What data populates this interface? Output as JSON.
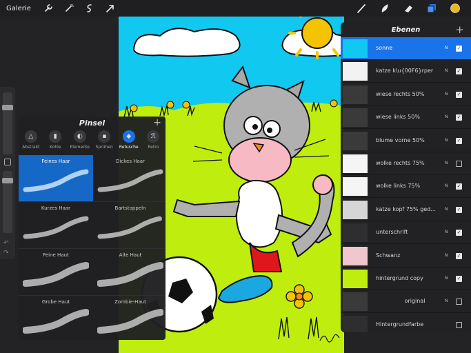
{
  "topbar": {
    "gallery_label": "Galerie",
    "left_tools": [
      "wrench-icon",
      "magic-wand-icon",
      "selection-icon",
      "transform-arrow-icon"
    ],
    "right_tools": [
      "brush-icon",
      "smudge-icon",
      "eraser-icon",
      "layers-icon"
    ],
    "active_color": "#e9b81e",
    "accent": "#1a73e8"
  },
  "brushes": {
    "title": "Pinsel",
    "categories": [
      {
        "label": "Abstrakt",
        "icon": "triangle-icon"
      },
      {
        "label": "Kohle",
        "icon": "charcoal-icon"
      },
      {
        "label": "Elemente",
        "icon": "elements-icon"
      },
      {
        "label": "Sprühen",
        "icon": "spray-icon"
      },
      {
        "label": "Retusche",
        "icon": "droplet-icon"
      },
      {
        "label": "Retro",
        "icon": "retro-icon"
      }
    ],
    "active_category": "Retusche",
    "items": [
      {
        "name": "Feines Haar",
        "selected": true
      },
      {
        "name": "Dickes Haar",
        "selected": false
      },
      {
        "name": "Kurzes Haar",
        "selected": false
      },
      {
        "name": "Bartstoppeln",
        "selected": false
      },
      {
        "name": "Feine Haut",
        "selected": false
      },
      {
        "name": "Alte Haut",
        "selected": false
      },
      {
        "name": "Grobe Haut",
        "selected": false
      },
      {
        "name": "Zombie-Haut",
        "selected": false
      }
    ]
  },
  "layers": {
    "title": "Ebenen",
    "items": [
      {
        "name": "sonne",
        "mode": "N",
        "visible": true,
        "selected": true
      },
      {
        "name": "katze k\\u{00F6}rper",
        "mode": "N",
        "visible": true,
        "selected": false
      },
      {
        "name": "wiese rechts 50%",
        "mode": "N",
        "visible": true,
        "selected": false
      },
      {
        "name": "wiese links 50%",
        "mode": "N",
        "visible": true,
        "selected": false
      },
      {
        "name": "blume vorne 50%",
        "mode": "N",
        "visible": true,
        "selected": false
      },
      {
        "name": "wolke rechts 75%",
        "mode": "N",
        "visible": false,
        "selected": false
      },
      {
        "name": "wolke links 75%",
        "mode": "N",
        "visible": true,
        "selected": false
      },
      {
        "name": "katze kopf 75% ged...",
        "mode": "N",
        "visible": true,
        "selected": false
      },
      {
        "name": "unterschrift",
        "mode": "N",
        "visible": true,
        "selected": false
      },
      {
        "name": "Schwanz",
        "mode": "N",
        "visible": true,
        "selected": false
      },
      {
        "name": "hintergrund copy",
        "mode": "N",
        "visible": true,
        "selected": false
      },
      {
        "name": "original",
        "mode": "N",
        "visible": false,
        "selected": false
      },
      {
        "name": "Hintergrundfarbe",
        "mode": "",
        "visible": false,
        "selected": false
      }
    ]
  }
}
